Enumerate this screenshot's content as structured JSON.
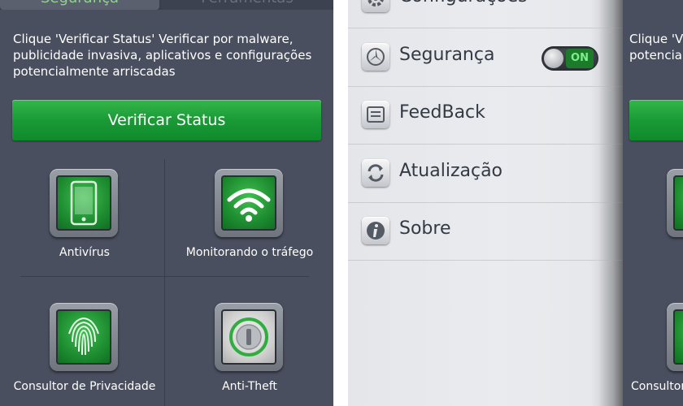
{
  "security": {
    "tabs": [
      "Segurança",
      "Ferramentas"
    ],
    "description": "Clique 'Verificar Status' Verificar por malware, publicidade invasiva, aplicativos e configurações potencialmente arriscadas",
    "scan_button": "Verificar Status",
    "features": [
      {
        "label": "Antivírus",
        "icon": "phone-icon"
      },
      {
        "label": "Monitorando o tráfego",
        "icon": "wifi-icon"
      },
      {
        "label": "Consultor de Privacidade",
        "icon": "fingerprint-icon"
      },
      {
        "label": "Anti-Theft",
        "icon": "lock-icon"
      }
    ]
  },
  "right_panel": {
    "description": "Clique 'V publicid potencial",
    "feature_label": "Consultor"
  },
  "menu": {
    "items": [
      {
        "label": "Configurações",
        "icon": "gear-icon"
      },
      {
        "label": "Segurança",
        "icon": "security-icon",
        "toggle": "ON"
      },
      {
        "label": "FeedBack",
        "icon": "feedback-icon"
      },
      {
        "label": "Atualização",
        "icon": "refresh-icon"
      },
      {
        "label": "Sobre",
        "icon": "info-icon"
      }
    ]
  },
  "colors": {
    "panel_bg": "#4a4f5f",
    "accent_green": "#1a9a36",
    "menu_bg": "#e9ebee",
    "menu_text": "#333a44"
  }
}
